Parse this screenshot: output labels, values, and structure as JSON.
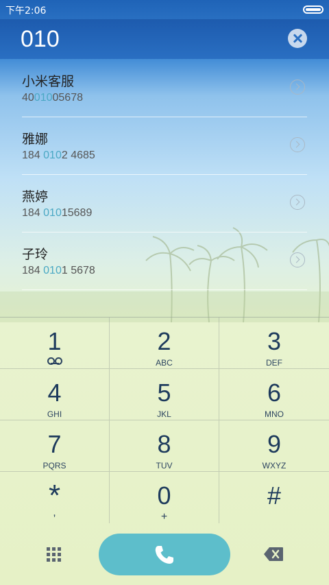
{
  "status_bar": {
    "time": "下午2:06"
  },
  "dial_input": {
    "value": "010"
  },
  "results": [
    {
      "name": "小米客服",
      "num_pre": "40",
      "num_hl": "010",
      "num_post": "05678"
    },
    {
      "name": "雅娜",
      "num_pre": "184 ",
      "num_hl": "010",
      "num_post": "2 4685"
    },
    {
      "name": "燕婷",
      "num_pre": "184 ",
      "num_hl": "010",
      "num_post": "15689"
    },
    {
      "name": "子玲",
      "num_pre": "184 ",
      "num_hl": "010",
      "num_post": "1 5678"
    }
  ],
  "keypad": [
    {
      "digit": "1",
      "letters": ""
    },
    {
      "digit": "2",
      "letters": "ABC"
    },
    {
      "digit": "3",
      "letters": "DEF"
    },
    {
      "digit": "4",
      "letters": "GHI"
    },
    {
      "digit": "5",
      "letters": "JKL"
    },
    {
      "digit": "6",
      "letters": "MNO"
    },
    {
      "digit": "7",
      "letters": "PQRS"
    },
    {
      "digit": "8",
      "letters": "TUV"
    },
    {
      "digit": "9",
      "letters": "WXYZ"
    },
    {
      "digit": "*",
      "letters": ","
    },
    {
      "digit": "0",
      "letters": "+"
    },
    {
      "digit": "#",
      "letters": ""
    }
  ],
  "icons": {
    "clear": "close-circle-icon",
    "voicemail": "voicemail-icon",
    "keypad_toggle": "dialpad-grid-icon",
    "call": "phone-icon",
    "delete": "backspace-icon",
    "row_detail": "chevron-right-circle-icon"
  },
  "colors": {
    "header": "#2a6fc2",
    "highlight": "#4aa8c4",
    "call_button": "#5dbecb",
    "key_text": "#1d3a5c"
  }
}
